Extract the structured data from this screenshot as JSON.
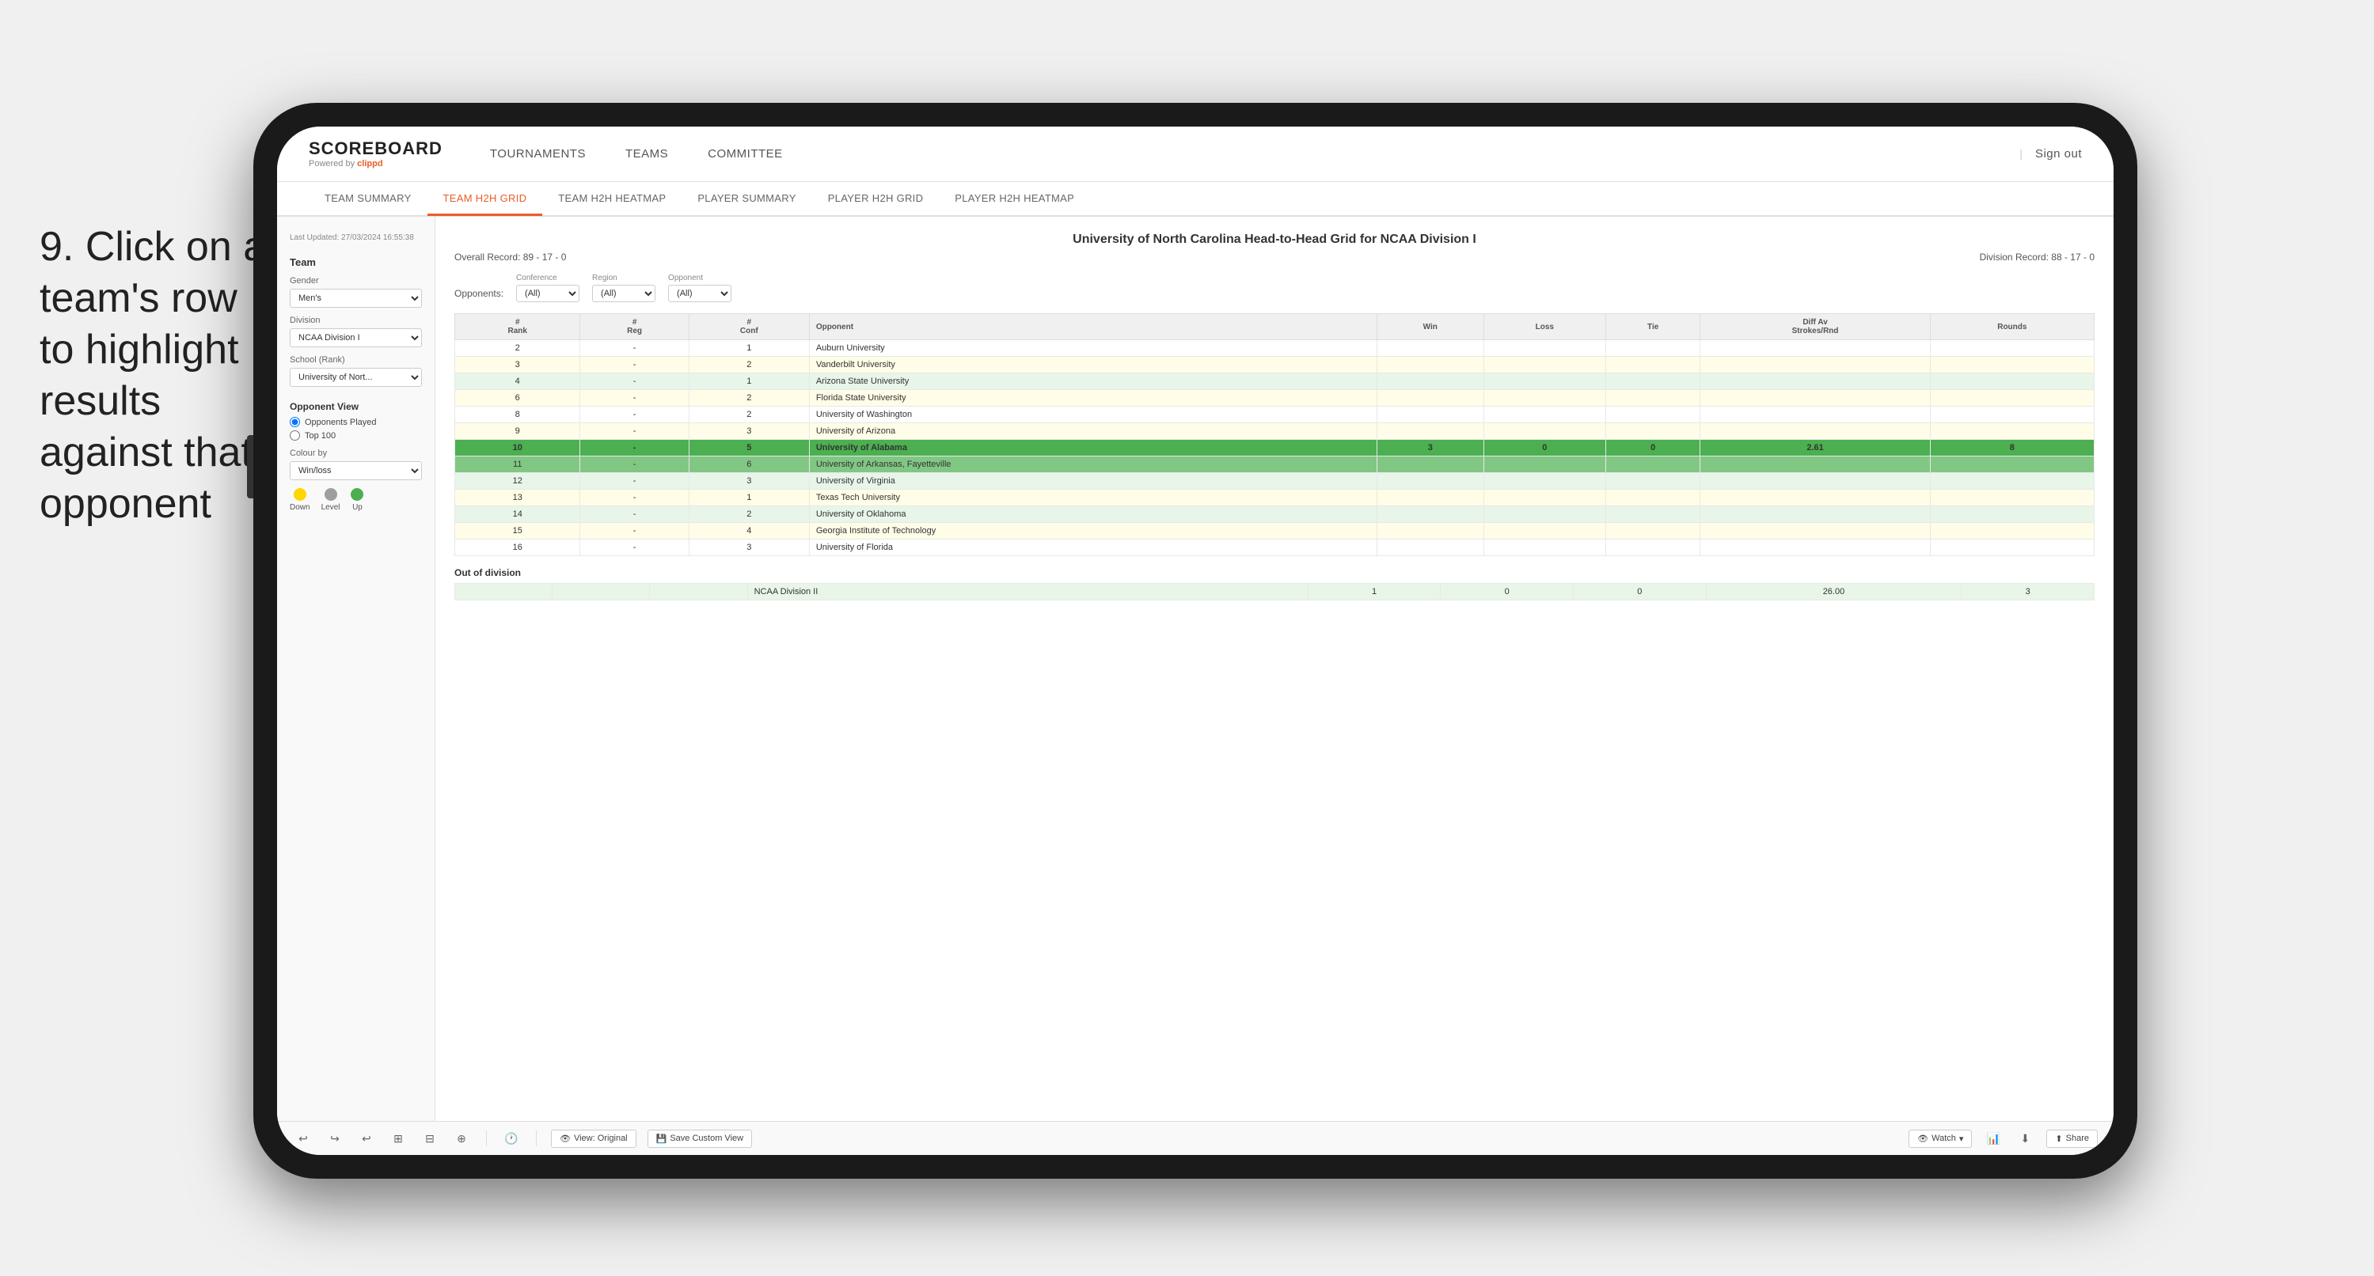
{
  "instruction": {
    "step": "9.",
    "text": "Click on a team's row to highlight results against that opponent"
  },
  "app": {
    "logo": "SCOREBOARD",
    "powered_by": "Powered by ",
    "clippd": "clippd",
    "sign_out": "Sign out"
  },
  "nav": {
    "items": [
      "TOURNAMENTS",
      "TEAMS",
      "COMMITTEE"
    ]
  },
  "sub_nav": {
    "items": [
      "TEAM SUMMARY",
      "TEAM H2H GRID",
      "TEAM H2H HEATMAP",
      "PLAYER SUMMARY",
      "PLAYER H2H GRID",
      "PLAYER H2H HEATMAP"
    ],
    "active": "TEAM H2H GRID"
  },
  "sidebar": {
    "timestamp": "Last Updated: 27/03/2024\n16:55:38",
    "team_label": "Team",
    "gender_label": "Gender",
    "gender_value": "Men's",
    "division_label": "Division",
    "division_value": "NCAA Division I",
    "school_label": "School (Rank)",
    "school_value": "University of Nort...",
    "opponent_view_label": "Opponent View",
    "radio_options": [
      "Opponents Played",
      "Top 100"
    ],
    "colour_by_label": "Colour by",
    "colour_by_value": "Win/loss",
    "colours": [
      {
        "label": "Down",
        "color": "#ffd600"
      },
      {
        "label": "Level",
        "color": "#9e9e9e"
      },
      {
        "label": "Up",
        "color": "#4caf50"
      }
    ]
  },
  "grid": {
    "title": "University of North Carolina Head-to-Head Grid for NCAA Division I",
    "overall_record": "Overall Record: 89 - 17 - 0",
    "division_record": "Division Record: 88 - 17 - 0",
    "filters": {
      "conference_label": "Conference",
      "conference_value": "(All)",
      "region_label": "Region",
      "region_value": "(All)",
      "opponent_label": "Opponent",
      "opponent_value": "(All)",
      "opponents_label": "Opponents:"
    },
    "columns": [
      "#\nRank",
      "#\nReg",
      "#\nConf",
      "Opponent",
      "Win",
      "Loss",
      "Tie",
      "Diff Av\nStrokes/Rnd",
      "Rounds"
    ],
    "rows": [
      {
        "rank": "2",
        "reg": "-",
        "conf": "1",
        "opponent": "Auburn University",
        "win": "",
        "loss": "",
        "tie": "",
        "diff": "",
        "rounds": "",
        "style": "normal"
      },
      {
        "rank": "3",
        "reg": "-",
        "conf": "2",
        "opponent": "Vanderbilt University",
        "win": "",
        "loss": "",
        "tie": "",
        "diff": "",
        "rounds": "",
        "style": "light-yellow"
      },
      {
        "rank": "4",
        "reg": "-",
        "conf": "1",
        "opponent": "Arizona State University",
        "win": "",
        "loss": "",
        "tie": "",
        "diff": "",
        "rounds": "",
        "style": "light-green"
      },
      {
        "rank": "6",
        "reg": "-",
        "conf": "2",
        "opponent": "Florida State University",
        "win": "",
        "loss": "",
        "tie": "",
        "diff": "",
        "rounds": "",
        "style": "light-yellow"
      },
      {
        "rank": "8",
        "reg": "-",
        "conf": "2",
        "opponent": "University of Washington",
        "win": "",
        "loss": "",
        "tie": "",
        "diff": "",
        "rounds": "",
        "style": "normal"
      },
      {
        "rank": "9",
        "reg": "-",
        "conf": "3",
        "opponent": "University of Arizona",
        "win": "",
        "loss": "",
        "tie": "",
        "diff": "",
        "rounds": "",
        "style": "light-yellow"
      },
      {
        "rank": "10",
        "reg": "-",
        "conf": "5",
        "opponent": "University of Alabama",
        "win": "3",
        "loss": "0",
        "tie": "0",
        "diff": "2.61",
        "rounds": "8",
        "style": "highlighted"
      },
      {
        "rank": "11",
        "reg": "-",
        "conf": "6",
        "opponent": "University of Arkansas, Fayetteville",
        "win": "",
        "loss": "",
        "tie": "",
        "diff": "",
        "rounds": "",
        "style": "selected"
      },
      {
        "rank": "12",
        "reg": "-",
        "conf": "3",
        "opponent": "University of Virginia",
        "win": "",
        "loss": "",
        "tie": "",
        "diff": "",
        "rounds": "",
        "style": "light-green"
      },
      {
        "rank": "13",
        "reg": "-",
        "conf": "1",
        "opponent": "Texas Tech University",
        "win": "",
        "loss": "",
        "tie": "",
        "diff": "",
        "rounds": "",
        "style": "light-yellow"
      },
      {
        "rank": "14",
        "reg": "-",
        "conf": "2",
        "opponent": "University of Oklahoma",
        "win": "",
        "loss": "",
        "tie": "",
        "diff": "",
        "rounds": "",
        "style": "light-green"
      },
      {
        "rank": "15",
        "reg": "-",
        "conf": "4",
        "opponent": "Georgia Institute of Technology",
        "win": "",
        "loss": "",
        "tie": "",
        "diff": "",
        "rounds": "",
        "style": "light-yellow"
      },
      {
        "rank": "16",
        "reg": "-",
        "conf": "3",
        "opponent": "University of Florida",
        "win": "",
        "loss": "",
        "tie": "",
        "diff": "",
        "rounds": "",
        "style": "normal"
      }
    ],
    "out_of_division_label": "Out of division",
    "out_division_rows": [
      {
        "division": "NCAA Division II",
        "win": "1",
        "loss": "0",
        "tie": "0",
        "diff": "26.00",
        "rounds": "3",
        "style": "out-division"
      }
    ]
  },
  "toolbar": {
    "view_label": "View: Original",
    "save_label": "Save Custom View",
    "watch_label": "Watch",
    "share_label": "Share"
  }
}
